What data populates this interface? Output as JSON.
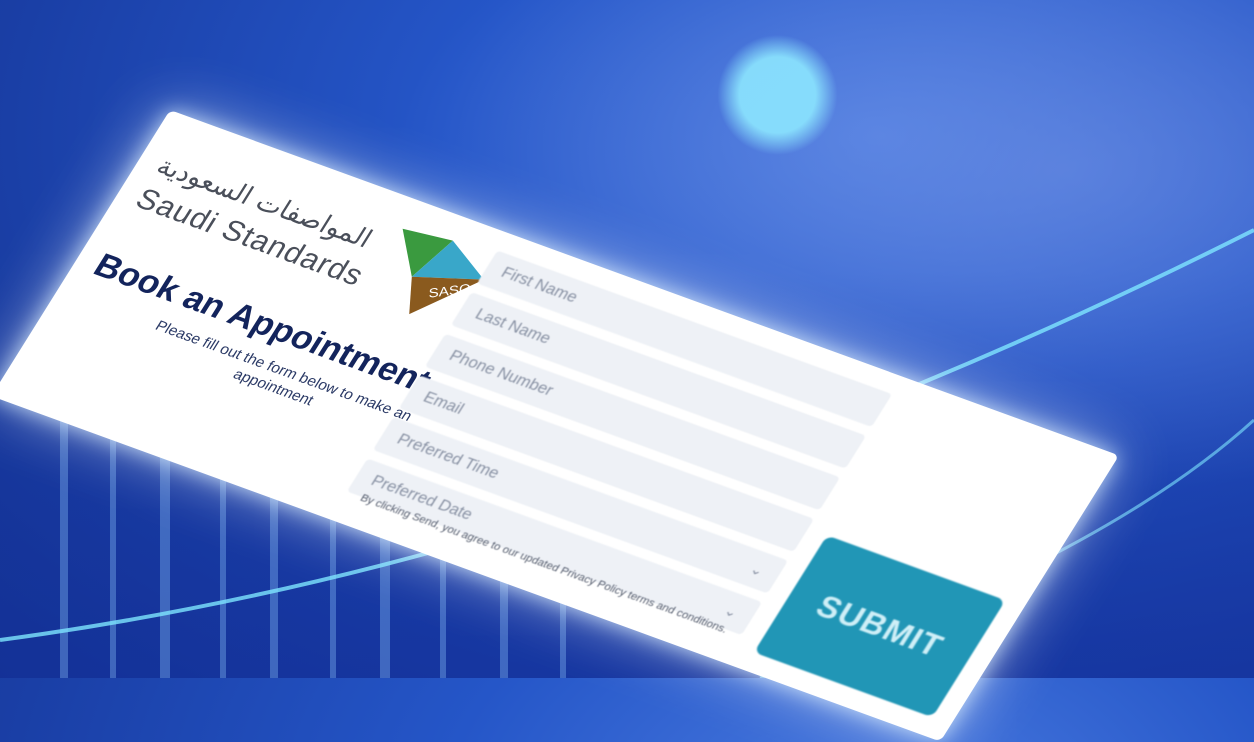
{
  "brand": {
    "arabic_name": "المواصفات السعودية",
    "english_name": "Saudi Standards",
    "mark_text": "SASO"
  },
  "form": {
    "title": "Book an Appointment",
    "subtitle": "Please fill out the form below to make an appointment",
    "fields": [
      {
        "placeholder": "First Name",
        "type": "text"
      },
      {
        "placeholder": "Last Name",
        "type": "text"
      },
      {
        "placeholder": "Phone Number",
        "type": "text"
      },
      {
        "placeholder": "Email",
        "type": "text"
      },
      {
        "placeholder": "Preferred Time",
        "type": "select"
      },
      {
        "placeholder": "Preferred Date",
        "type": "select"
      }
    ],
    "consent_text": "By clicking Send, you agree to our updated Privacy Policy terms and conditions.",
    "submit_label": "SUBMIT"
  },
  "colors": {
    "background": "#2556c8",
    "title": "#13245c",
    "submit": "#2196b6",
    "logo_green": "#3a9a3f",
    "logo_blue": "#39a7c9",
    "logo_brown": "#8a5a1e"
  },
  "icons": {
    "dropdown": "chevron-down-icon"
  }
}
